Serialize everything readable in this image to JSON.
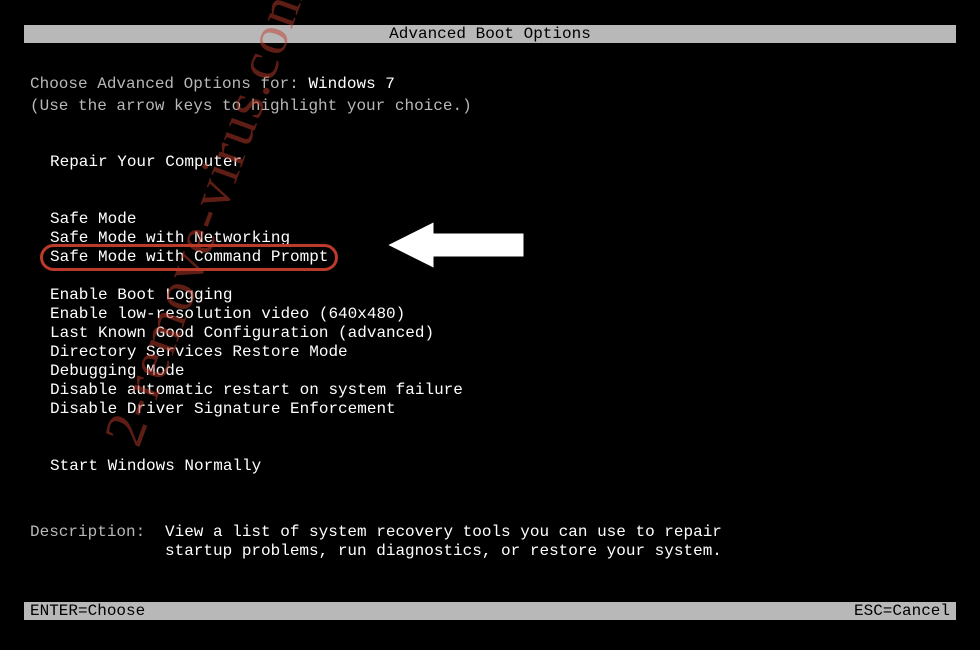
{
  "title": "Advanced Boot Options",
  "prompt": {
    "label": "Choose Advanced Options for: ",
    "os": "Windows 7",
    "hint": "(Use the arrow keys to highlight your choice.)"
  },
  "options": {
    "repair": "Repair Your Computer",
    "safe1": "Safe Mode",
    "safe2": "Safe Mode with Networking",
    "safe3": "Safe Mode with Command Prompt",
    "boot_logging": "Enable Boot Logging",
    "lowres": "Enable low-resolution video (640x480)",
    "lkgc": "Last Known Good Configuration (advanced)",
    "dsrm": "Directory Services Restore Mode",
    "debug": "Debugging Mode",
    "no_restart": "Disable automatic restart on system failure",
    "no_drvsig": "Disable Driver Signature Enforcement",
    "normal": "Start Windows Normally"
  },
  "description": {
    "label": "Description:",
    "text": "View a list of system recovery tools you can use to repair startup problems, run diagnostics, or restore your system."
  },
  "footer": {
    "enter": "ENTER=Choose",
    "esc": "ESC=Cancel"
  },
  "watermark": "2-remove-virus.com"
}
